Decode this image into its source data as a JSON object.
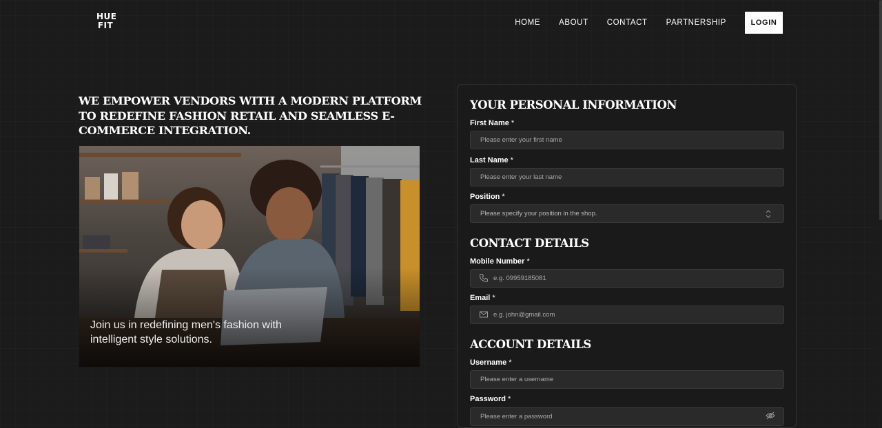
{
  "logo": {
    "line1": "HUE",
    "line2": "FIT"
  },
  "nav": {
    "home": "HOME",
    "about": "ABOUT",
    "contact": "CONTACT",
    "partnership": "PARTNERSHIP",
    "login": "LOGIN"
  },
  "hero": {
    "headline": "WE EMPOWER VENDORS WITH A MODERN PLATFORM TO REDEFINE FASHION RETAIL AND SEAMLESS E-COMMERCE INTEGRATION.",
    "caption": "Join us in redefining men's fashion with intelligent style solutions."
  },
  "form": {
    "personal": {
      "title": "YOUR PERSONAL INFORMATION",
      "first_name_label": "First Name",
      "first_name_placeholder": "Please enter your first name",
      "last_name_label": "Last Name",
      "last_name_placeholder": "Please enter your last name",
      "position_label": "Position",
      "position_placeholder": "Please specify your position in the shop."
    },
    "contact": {
      "title": "CONTACT DETAILS",
      "mobile_label": "Mobile Number",
      "mobile_placeholder": "e.g. 09959185081",
      "email_label": "Email",
      "email_placeholder": "e.g. john@gmail.com"
    },
    "account": {
      "title": "ACCOUNT DETAILS",
      "username_label": "Username",
      "username_placeholder": "Please enter a username",
      "password_label": "Password",
      "password_placeholder": "Please enter a password"
    },
    "required_mark": "*"
  },
  "icons": {
    "phone": "phone-icon",
    "mail": "mail-icon",
    "eye": "eye-off-icon",
    "select": "chevron-updown-icon"
  }
}
